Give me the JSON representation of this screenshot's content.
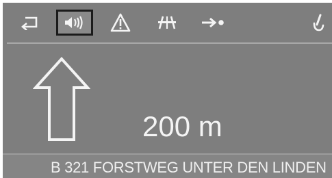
{
  "toolbar": {
    "items": [
      {
        "icon": "back-arrow-icon"
      },
      {
        "icon": "speaker-icon",
        "selected": true
      },
      {
        "icon": "warning-triangle-icon"
      },
      {
        "icon": "motorway-icon"
      },
      {
        "icon": "route-arrow-dot-icon"
      },
      {
        "icon": "hand-pointer-icon"
      }
    ]
  },
  "guidance": {
    "maneuver": "straight-ahead",
    "distance": "200 m"
  },
  "street": {
    "name": "B 321 FORSTWEG UNTER DEN LINDEN"
  },
  "colors": {
    "screen_background": "#7e7e7e",
    "foreground": "#f4f4f4",
    "selected_border": "#1b1b1b"
  }
}
